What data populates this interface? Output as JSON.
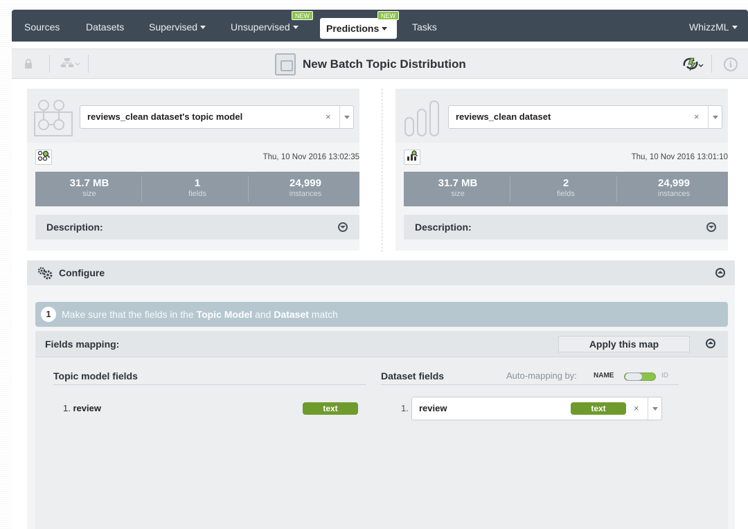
{
  "nav": {
    "items": [
      {
        "label": "Sources",
        "has_caret": false
      },
      {
        "label": "Datasets",
        "has_caret": false
      },
      {
        "label": "Supervised",
        "has_caret": true
      },
      {
        "label": "Unsupervised",
        "has_caret": true,
        "badge": "NEW"
      },
      {
        "label": "Predictions",
        "has_caret": true,
        "badge": "NEW",
        "active": true
      },
      {
        "label": "Tasks",
        "has_caret": false
      }
    ],
    "right_label": "WhizzML"
  },
  "toolbar": {
    "title": "New Batch Topic Distribution"
  },
  "left_panel": {
    "selected": "reviews_clean dataset's topic model",
    "clear_symbol": "×",
    "timestamp": "Thu, 10 Nov 2016 13:02:35",
    "stats": [
      {
        "value": "31.7 MB",
        "label": "size"
      },
      {
        "value": "1",
        "label": "fields"
      },
      {
        "value": "24,999",
        "label": "instances"
      }
    ],
    "description_label": "Description:"
  },
  "right_panel": {
    "selected": "reviews_clean dataset",
    "clear_symbol": "×",
    "timestamp": "Thu, 10 Nov 2016 13:01:10",
    "stats": [
      {
        "value": "31.7 MB",
        "label": "size"
      },
      {
        "value": "2",
        "label": "fields"
      },
      {
        "value": "24,999",
        "label": "instances"
      }
    ],
    "description_label": "Description:"
  },
  "configure": {
    "title": "Configure",
    "step": {
      "number": "1",
      "text_before": "Make sure that the fields in the ",
      "bold1": "Topic Model",
      "text_mid": " and ",
      "bold2": "Dataset",
      "text_after": " match"
    },
    "fields_mapping": {
      "title": "Fields mapping:",
      "apply_label": "Apply this map",
      "topic_model_header": "Topic model fields",
      "dataset_header": "Dataset fields",
      "auto_mapping_label": "Auto-mapping by:",
      "auto_mapping_name": "NAME",
      "auto_mapping_id": "ID",
      "topic_field": {
        "number": "1.",
        "name": "review",
        "type": "text"
      },
      "dataset_field": {
        "number": "1.",
        "name": "review",
        "type": "text",
        "clear_symbol": "×"
      }
    }
  },
  "colors": {
    "nav_bg": "#3e4a55",
    "badge_new": "#8bc34a",
    "stats_bg": "#8f9aa4",
    "pill_text_type": "#6f9a2c",
    "step_bar": "#b7c7d0"
  }
}
